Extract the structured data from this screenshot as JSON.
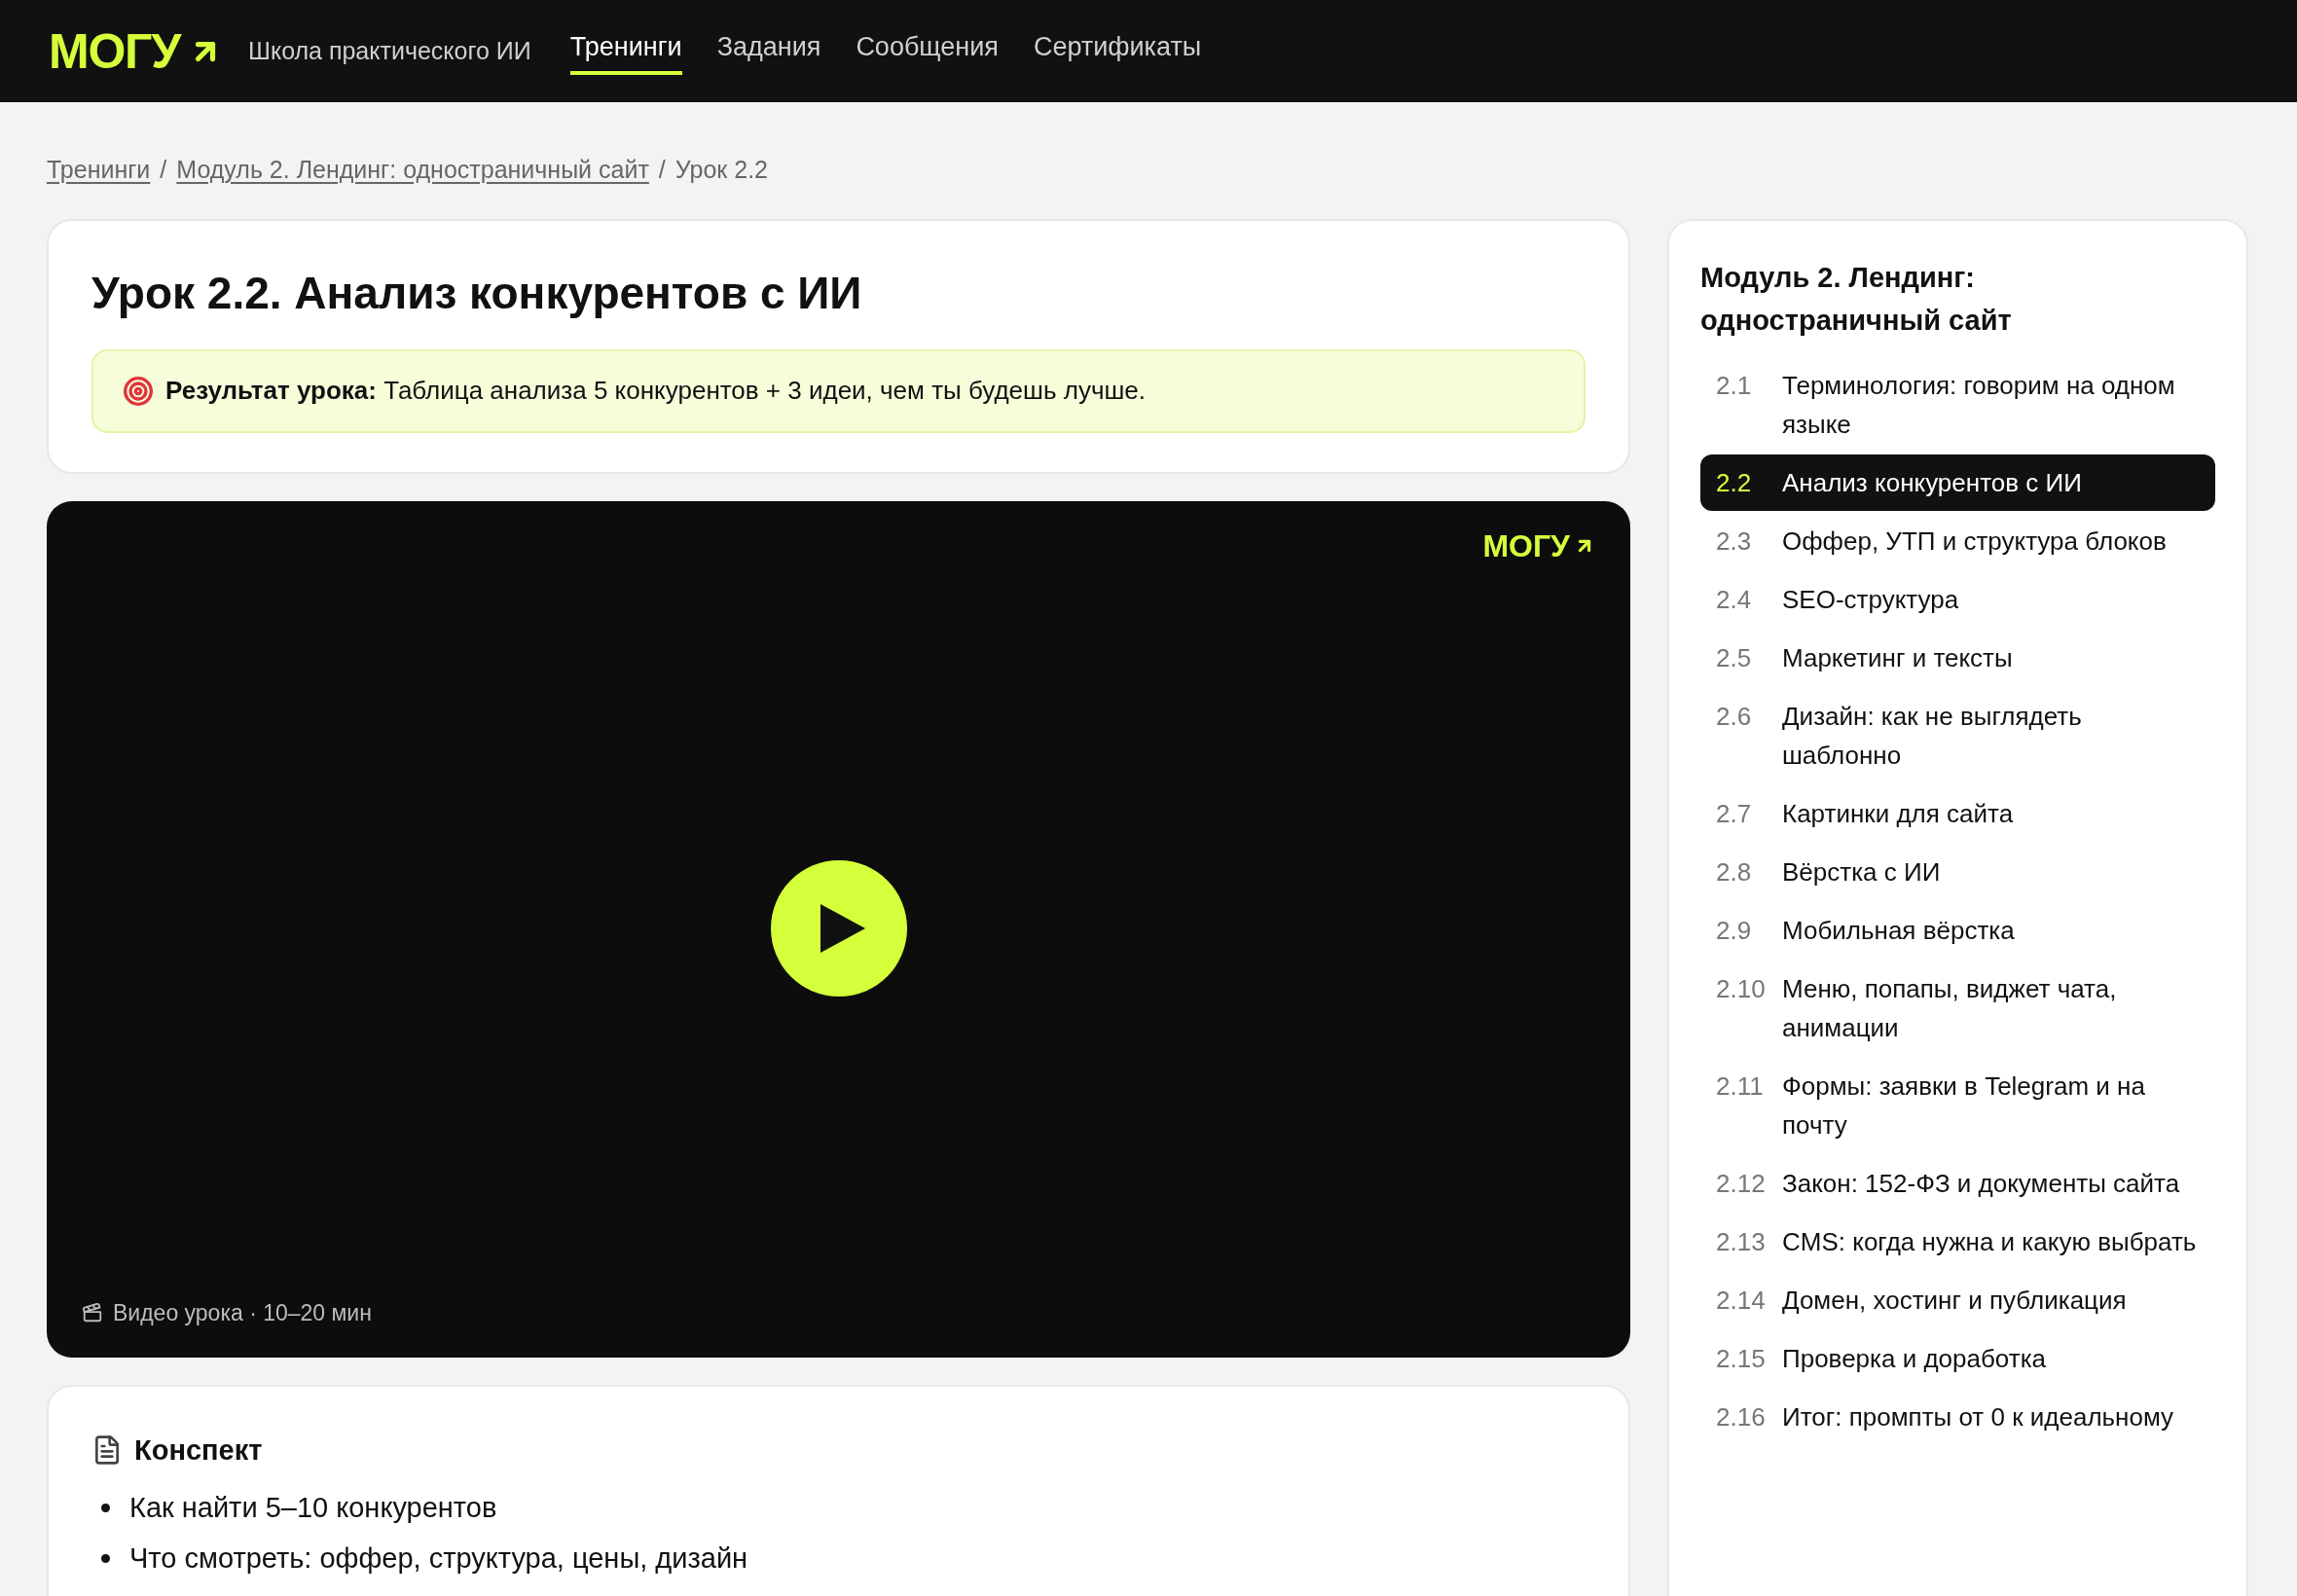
{
  "header": {
    "logo": "МОГУ",
    "tagline": "Школа практического ИИ",
    "nav": [
      {
        "label": "Тренинги",
        "selected": true
      },
      {
        "label": "Задания",
        "selected": false
      },
      {
        "label": "Сообщения",
        "selected": false
      },
      {
        "label": "Сертификаты",
        "selected": false
      }
    ]
  },
  "breadcrumb": {
    "separator": "/",
    "items": [
      {
        "label": "Тренинги",
        "link": true
      },
      {
        "label": "Модуль 2. Лендинг: одностраничный сайт",
        "link": true
      },
      {
        "label": "Урок 2.2",
        "link": false
      }
    ]
  },
  "lesson": {
    "title": "Урок 2.2. Анализ конкурентов с ИИ",
    "result_label": "Результат урока:",
    "result_text": "Таблица анализа 5 конкурентов + 3 идеи, чем ты будешь лучше."
  },
  "video": {
    "watermark": "МОГУ",
    "caption": "Видео урока · 10–20 мин"
  },
  "summary": {
    "title": "Конспект",
    "items": [
      "Как найти 5–10 конкурентов",
      "Что смотреть: оффер, структура, цены, дизайн"
    ]
  },
  "sidebar": {
    "title": "Модуль 2. Лендинг: одностраничный сайт",
    "lessons": [
      {
        "number": "2.1",
        "title": "Терминология: говорим на одном языке",
        "selected": false
      },
      {
        "number": "2.2",
        "title": "Анализ конкурентов с ИИ",
        "selected": true
      },
      {
        "number": "2.3",
        "title": "Оффер, УТП и структура блоков",
        "selected": false
      },
      {
        "number": "2.4",
        "title": "SEO-структура",
        "selected": false
      },
      {
        "number": "2.5",
        "title": "Маркетинг и тексты",
        "selected": false
      },
      {
        "number": "2.6",
        "title": "Дизайн: как не выглядеть шаблонно",
        "selected": false
      },
      {
        "number": "2.7",
        "title": "Картинки для сайта",
        "selected": false
      },
      {
        "number": "2.8",
        "title": "Вёрстка с ИИ",
        "selected": false
      },
      {
        "number": "2.9",
        "title": "Мобильная вёрстка",
        "selected": false
      },
      {
        "number": "2.10",
        "title": "Меню, попапы, виджет чата, анимации",
        "selected": false
      },
      {
        "number": "2.11",
        "title": "Формы: заявки в Telegram и на почту",
        "selected": false
      },
      {
        "number": "2.12",
        "title": "Закон: 152-ФЗ и документы сайта",
        "selected": false
      },
      {
        "number": "2.13",
        "title": "CMS: когда нужна и какую выбрать",
        "selected": false
      },
      {
        "number": "2.14",
        "title": "Домен, хостинг и публикация",
        "selected": false
      },
      {
        "number": "2.15",
        "title": "Проверка и доработка",
        "selected": false
      },
      {
        "number": "2.16",
        "title": "Итог: промпты от 0 к идеальному",
        "selected": false
      }
    ]
  }
}
